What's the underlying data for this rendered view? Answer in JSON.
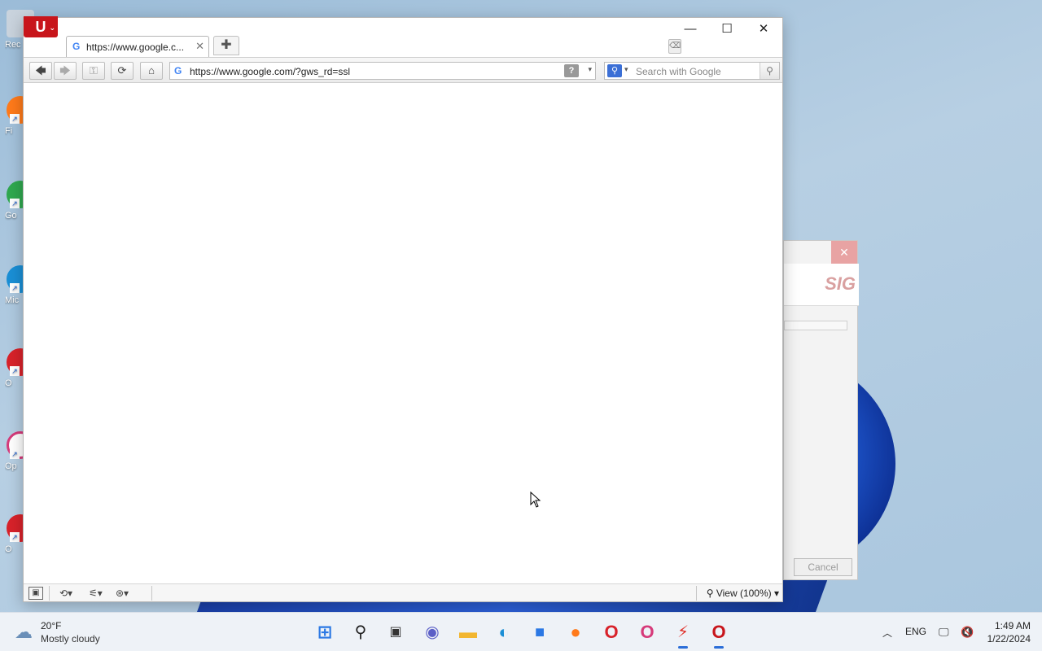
{
  "desktop": {
    "icons": [
      {
        "label": "Rec",
        "color": "#c9d3dd"
      },
      {
        "label": "Fi",
        "color": "#ff7a1a"
      },
      {
        "label": "Go",
        "color": "#2fa84f"
      },
      {
        "label": "Mic",
        "color": "#1a8fd6"
      },
      {
        "label": "O",
        "color": "#d8222a"
      },
      {
        "label": "Op",
        "color": "#d63a7a"
      },
      {
        "label": "O",
        "color": "#d8222a"
      }
    ]
  },
  "background_dialog": {
    "close_glyph": "✕",
    "logo_text": "SIG",
    "cancel_label": "Cancel"
  },
  "browser": {
    "app_menu_icon": "opera-logo",
    "app_menu_glyph": "U",
    "tab": {
      "title": "https://www.google.c...",
      "favicon": "G",
      "close_glyph": "✕"
    },
    "new_tab_glyph": "✚",
    "window_controls": {
      "minimize": "—",
      "maximize": "☐",
      "close": "✕"
    },
    "toolbar": {
      "back": "🡄",
      "forward": "🡆",
      "key": "⚿",
      "reload": "⟳",
      "home": "⌂"
    },
    "address_bar": {
      "favicon": "G",
      "url": "https://www.google.com/?gws_rd=ssl",
      "info_glyph": "?",
      "dropdown_glyph": "▾"
    },
    "search": {
      "engine_glyph": "⚲",
      "dropdown_glyph": "▾",
      "placeholder": "Search with Google",
      "go_glyph": "⚲"
    },
    "statusbar": {
      "panel_toggle": "▣",
      "sync": "⟲▾",
      "share": "⚟▾",
      "turbo": "⊛▾",
      "zoom_label": "View (100%)"
    }
  },
  "taskbar": {
    "weather": {
      "temp": "20°F",
      "condition": "Mostly cloudy"
    },
    "apps": [
      {
        "name": "start",
        "glyph": "⊞",
        "color": "#2b78e4"
      },
      {
        "name": "search",
        "glyph": "⚲",
        "color": "#222222"
      },
      {
        "name": "task-view",
        "glyph": "▣",
        "color": "#333333"
      },
      {
        "name": "chat",
        "glyph": "◉",
        "color": "#5b5fc7"
      },
      {
        "name": "file-explorer",
        "glyph": "▬",
        "color": "#f2b630"
      },
      {
        "name": "edge",
        "glyph": "◐",
        "color": "#1a8fd6"
      },
      {
        "name": "store",
        "glyph": "■",
        "color": "#2b78e4"
      },
      {
        "name": "firefox",
        "glyph": "●",
        "color": "#ff7a1a"
      },
      {
        "name": "opera",
        "glyph": "O",
        "color": "#d8222a"
      },
      {
        "name": "opera-gx",
        "glyph": "O",
        "color": "#d63a7a"
      },
      {
        "name": "flash",
        "glyph": "⚡",
        "color": "#e0322b"
      },
      {
        "name": "opera-legacy",
        "glyph": "O",
        "color": "#c8151b"
      }
    ],
    "tray": {
      "chevron": "︿",
      "language": "ENG",
      "network": "🖵",
      "volume": "🔇"
    },
    "clock": {
      "time": "1:49 AM",
      "date": "1/22/2024"
    }
  }
}
